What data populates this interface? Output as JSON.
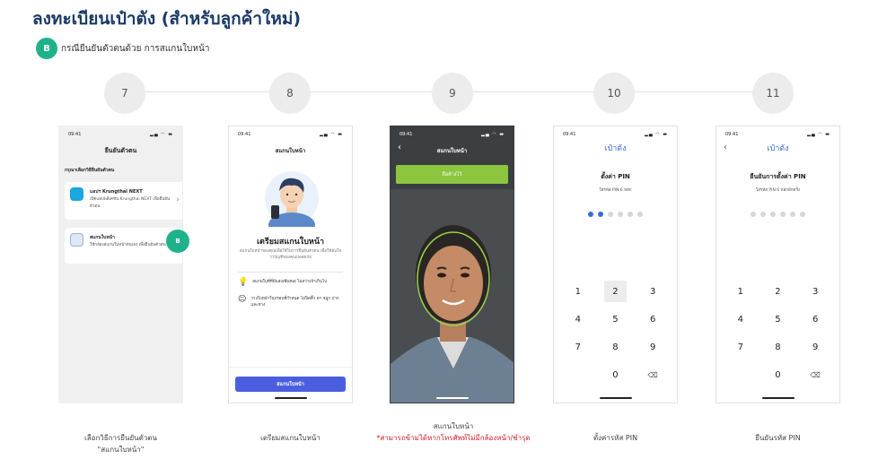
{
  "header": {
    "title": "ลงทะเบียนเป๋าตัง (สำหรับลูกค้าใหม่)",
    "badge": "B",
    "subtitle": "กรณียืนยันตัวตนด้วย การสแกนใบหน้า"
  },
  "steps": [
    "7",
    "8",
    "9",
    "10",
    "11"
  ],
  "phone1": {
    "time": "09:41",
    "title": "ยืนยันตัวตน",
    "label": "กรุณาเลือกวิธียืนยันตัวตน",
    "option1_title": "แอปฯ Krungthai NEXT",
    "option1_desc": "เปิดแอปพลิเคชัน Krungthai NEXT เพื่อยืนยันตัวตน",
    "option2_title": "สแกนใบหน้า",
    "option2_desc": "ใช้กล้องสแกนใบหน้าตนเอง เพื่อยืนยันตัวตน",
    "badge": "B",
    "caption_line1": "เลือกวิธีการยืนยันตัวตน",
    "caption_line2": "\"สแกนใบหน้า\""
  },
  "phone2": {
    "time": "09:41",
    "title": "สแกนใบหน้า",
    "heading": "เตรียมสแกนใบหน้า",
    "desc": "สแกนใบหน้าของคุณเพื่อใช้ในการยืนยันตัวตน เพื่อให้มั่นใจว่าบัญชีของคุณปลอดภัย",
    "tip1": "สแกนในที่ที่มีแสงเพียงพอ ไม่สว่างจ้าเกินไป",
    "tip2": "วางใบหน้าในกรอบที่กำหนด ไม่ปิดคิ้ว ตา จมูก ปาก และหาง",
    "button": "สแกนใบหน้า",
    "caption": "เตรียมสแกนใบหน้า"
  },
  "phone3": {
    "time": "09:41",
    "title": "สแกนใบหน้า",
    "status_bar": "ถือค้างไว้",
    "caption_line1": "สแกนใบหน้า",
    "caption_line2": "*สามารถข้ามได้หากโทรศัพท์ไม่มีกล้องหน้า/ชำรุด"
  },
  "phone4": {
    "time": "09:41",
    "app_title": "เป๋าตัง",
    "heading": "ตั้งค่า PIN",
    "hint": "ใส่รหัส PIN 6 หลัก",
    "filled_dots": 2,
    "keys": [
      "1",
      "2",
      "3",
      "4",
      "5",
      "6",
      "7",
      "8",
      "9",
      "",
      "0",
      "⌫"
    ],
    "caption": "ตั้งค่ารหัส PIN"
  },
  "phone5": {
    "time": "09:41",
    "app_title": "เป๋าตัง",
    "heading": "ยืนยันการตั้งค่า PIN",
    "hint": "ใส่รหัส PIN 6 หลักอีกครั้ง",
    "filled_dots": 0,
    "keys": [
      "1",
      "2",
      "3",
      "4",
      "5",
      "6",
      "7",
      "8",
      "9",
      "",
      "0",
      "⌫"
    ],
    "caption": "ยืนยันรหัส PIN"
  },
  "colors": {
    "title": "#1a3a66",
    "accent_green": "#1fb28a",
    "primary_blue": "#4a5ee0",
    "pin_blue": "#3a6ad6",
    "face_guide": "#8cc63f"
  }
}
